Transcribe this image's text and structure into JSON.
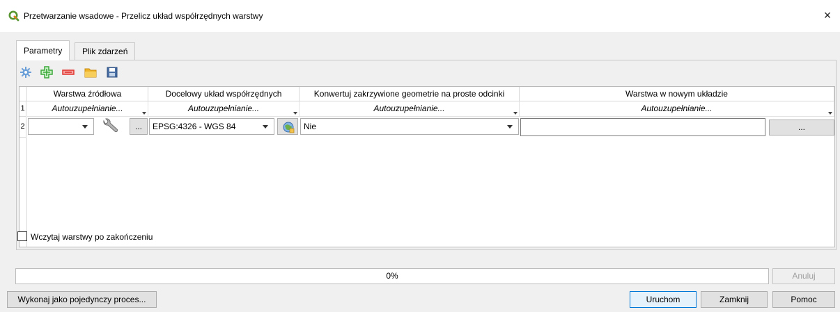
{
  "window": {
    "title": "Przetwarzanie wsadowe - Przelicz układ współrzędnych warstwy",
    "close_glyph": "×",
    "app_icon": "qgis-logo-icon"
  },
  "tabs": [
    {
      "label": "Parametry",
      "active": true
    },
    {
      "label": "Plik zdarzeń",
      "active": false
    }
  ],
  "toolbar": {
    "icons": [
      "autofill-gear-icon",
      "add-row-icon",
      "remove-row-icon",
      "open-folder-icon",
      "save-icon"
    ]
  },
  "table": {
    "headers": [
      "Warstwa źródłowa",
      "Docelowy układ współrzędnych",
      "Konwertuj zakrzywione geometrie na proste odcinki",
      "Warstwa w nowym układzie"
    ],
    "row_numbers": [
      "1",
      "2"
    ],
    "autofill_label": "Autouzupełnianie...",
    "row2": {
      "source_layer_value": "",
      "source_browse_label": "...",
      "crs_value": "EPSG:4326 - WGS 84",
      "convert_value": "Nie",
      "output_value": "",
      "output_browse_label": "..."
    }
  },
  "options": {
    "load_layers_label": "Wczytaj warstwy po zakończeniu",
    "load_layers_checked": false
  },
  "progress": {
    "value": 0,
    "label": "0%"
  },
  "buttons": {
    "cancel": "Anuluj",
    "run_single": "Wykonaj jako pojedynczy proces...",
    "run": "Uruchom",
    "close": "Zamknij",
    "help": "Pomoc"
  },
  "colors": {
    "qgis_green": "#589632",
    "qgis_yellow": "#ee7913",
    "add_green": "#3aa83a",
    "remove_red": "#e0342f",
    "folder_yellow": "#f0b429",
    "save_blue": "#4a6fa5",
    "default_button_border": "#0078d7"
  }
}
